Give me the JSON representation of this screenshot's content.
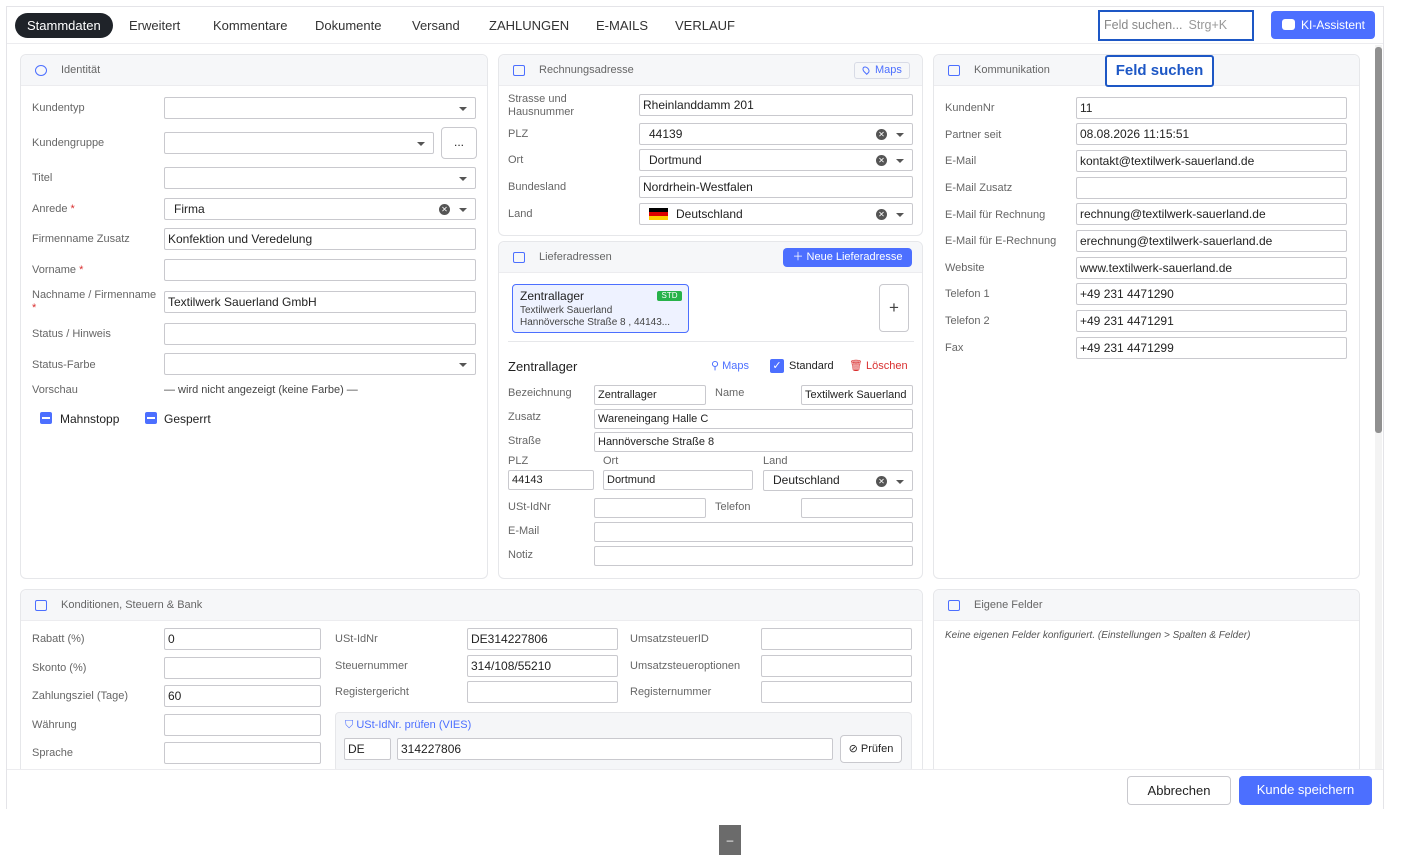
{
  "tabs": [
    "Stammdaten",
    "Erweitert",
    "Kommentare",
    "Dokumente",
    "Versand",
    "ZAHLUNGEN",
    "E-MAILS",
    "VERLAUF"
  ],
  "search": {
    "placeholder": "Feld suchen...",
    "shortcut": "Strg+K"
  },
  "ki_button": "KI-Assistent",
  "tooltip": "Feld suchen",
  "identitaet": {
    "title": "Identität",
    "kundentyp_label": "Kundentyp",
    "kundentyp": "",
    "kundengruppe_label": "Kundengruppe",
    "kundengruppe": "",
    "dots": "...",
    "titel_label": "Titel",
    "titel": "",
    "anrede_label": "Anrede",
    "anrede": "Firma",
    "fzusatz_label": "Firmenname Zusatz",
    "fzusatz": "Konfektion und Veredelung",
    "vorname_label": "Vorname",
    "vorname": "",
    "nachname_label": "Nachname / Firmenname",
    "nachname": "Textilwerk Sauerland GmbH",
    "status_label": "Status / Hinweis",
    "status": "",
    "farbe_label": "Status-Farbe",
    "farbe": "",
    "vorschau_label": "Vorschau",
    "vorschau": "— wird nicht angezeigt (keine Farbe) —",
    "mahnstopp": "Mahnstopp",
    "gesperrt": "Gesperrt",
    "required_mark": "*"
  },
  "rechnung": {
    "title": "Rechnungsadresse",
    "maps": "Maps",
    "strasse_label": "Strasse und Hausnummer",
    "strasse": "Rheinlanddamm 201",
    "plz_label": "PLZ",
    "plz": "44139",
    "ort_label": "Ort",
    "ort": "Dortmund",
    "bundesland_label": "Bundesland",
    "bundesland": "Nordrhein-Westfalen",
    "land_label": "Land",
    "land": "Deutschland"
  },
  "liefer": {
    "title": "Lieferadressen",
    "new_button": "Neue Lieferadresse",
    "card_title": "Zentrallager",
    "card_badge": "STD",
    "card_line1": "Textilwerk Sauerland",
    "card_line2": "Hannöversche Straße 8 ,  44143...",
    "add": "+",
    "detail_title": "Zentrallager",
    "maps": "Maps",
    "standard": "Standard",
    "delete": "Löschen",
    "bezeichnung_label": "Bezeichnung",
    "bezeichnung": "Zentrallager",
    "name_label": "Name",
    "name": "Textilwerk Sauerland",
    "zusatz_label": "Zusatz",
    "zusatz": "Wareneingang Halle C",
    "strasse_label": "Straße",
    "strasse": "Hannöversche Straße 8",
    "plz_label": "PLZ",
    "plz": "44143",
    "ort_label": "Ort",
    "ort": "Dortmund",
    "land_label": "Land",
    "land": "Deutschland",
    "ust_label": "USt-IdNr",
    "ust": "",
    "telefon_label": "Telefon",
    "telefon": "",
    "email_label": "E-Mail",
    "email": "",
    "notiz_label": "Notiz",
    "notiz": ""
  },
  "komm": {
    "title": "Kommunikation",
    "rows": [
      {
        "label": "KundenNr",
        "value": "11"
      },
      {
        "label": "Partner seit",
        "value": "08.08.2026 11:15:51"
      },
      {
        "label": "E-Mail",
        "value": "kontakt@textilwerk-sauerland.de"
      },
      {
        "label": "E-Mail Zusatz",
        "value": ""
      },
      {
        "label": "E-Mail für Rechnung",
        "value": "rechnung@textilwerk-sauerland.de"
      },
      {
        "label": "E-Mail für E-Rechnung",
        "value": "erechnung@textilwerk-sauerland.de"
      },
      {
        "label": "Website",
        "value": "www.textilwerk-sauerland.de"
      },
      {
        "label": "Telefon 1",
        "value": "+49 231 4471290"
      },
      {
        "label": "Telefon 2",
        "value": "+49 231 4471291"
      },
      {
        "label": "Fax",
        "value": "+49 231 4471299"
      }
    ]
  },
  "kond": {
    "title": "Konditionen, Steuern & Bank",
    "rabatt_label": "Rabatt (%)",
    "rabatt": "0",
    "skonto_label": "Skonto (%)",
    "skonto": "",
    "ziel_label": "Zahlungsziel (Tage)",
    "ziel": "60",
    "waehrung_label": "Währung",
    "waehrung": "",
    "sprache_label": "Sprache",
    "sprache": "",
    "ust_label": "USt-IdNr",
    "ust": "DE314227806",
    "stnr_label": "Steuernummer",
    "stnr": "314/108/55210",
    "reggericht_label": "Registergericht",
    "reggericht": "",
    "ustid_label": "UmsatzsteuerID",
    "ustid": "",
    "ustopt_label": "Umsatzsteueroptionen",
    "ustopt": "",
    "regnr_label": "Registernummer",
    "regnr": "",
    "vies_title": "USt-IdNr. prüfen (VIES)",
    "vies_cc": "DE",
    "vies_nr": "314227806",
    "vies_btn": "Prüfen"
  },
  "eigene": {
    "title": "Eigene Felder",
    "note": "Keine eigenen Felder konfiguriert. (Einstellungen > Spalten & Felder)"
  },
  "footer": {
    "cancel": "Abbrechen",
    "save": "Kunde speichern"
  },
  "mini": "–"
}
